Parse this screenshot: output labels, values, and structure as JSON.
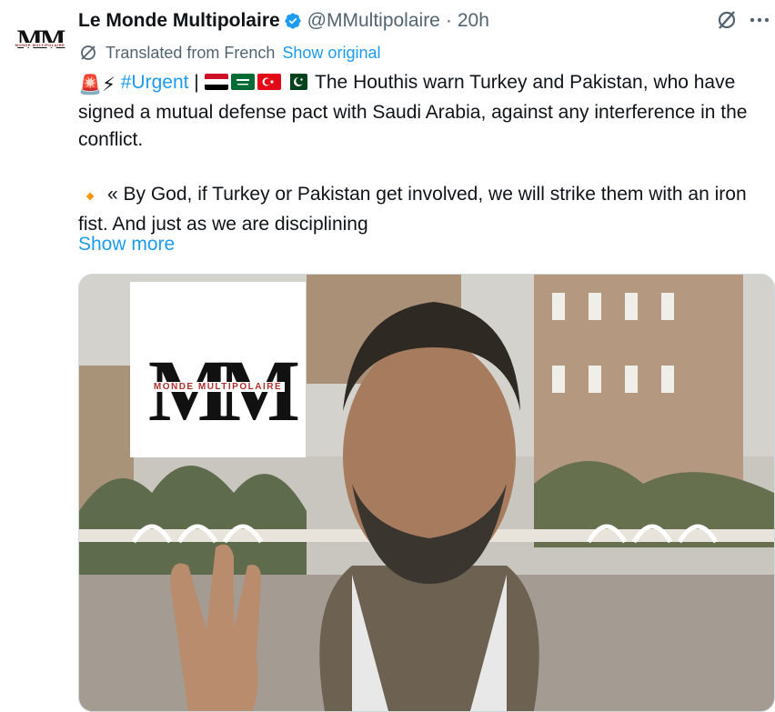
{
  "account": {
    "avatar_letters": "MM",
    "avatar_sub": "MONDE MULTIPOLAIRE",
    "display_name": "Le Monde Multipolaire",
    "handle": "@MMultipolaire",
    "separator": "·",
    "time": "20h"
  },
  "icons": {
    "verified": "verified-badge-icon",
    "grok": "grok-icon",
    "more": "more-icon",
    "translate": "translate-globe-icon"
  },
  "translation": {
    "label": "Translated from French",
    "show_original": "Show original"
  },
  "tweet": {
    "emoji_siren": "🚨",
    "emoji_bolt": "⚡",
    "hashtag": "#Urgent",
    "pipe": " | ",
    "line1": " The Houthis warn Turkey and Pakistan, who have signed a mutual defense pact with Saudi Arabia, against any interference in the conflict.",
    "bullet": "🔸",
    "line2": " « By God, if Turkey or Pakistan get involved, we will strike them with an iron fist. And just as we are disciplining",
    "show_more": "Show more"
  },
  "media": {
    "logo_letters": "MM",
    "logo_tag": "MONDE MULTIPOLAIRE"
  },
  "colors": {
    "link": "#1d9bf0",
    "text": "#0f1419",
    "secondary": "#536471",
    "border": "#cfd9de"
  }
}
